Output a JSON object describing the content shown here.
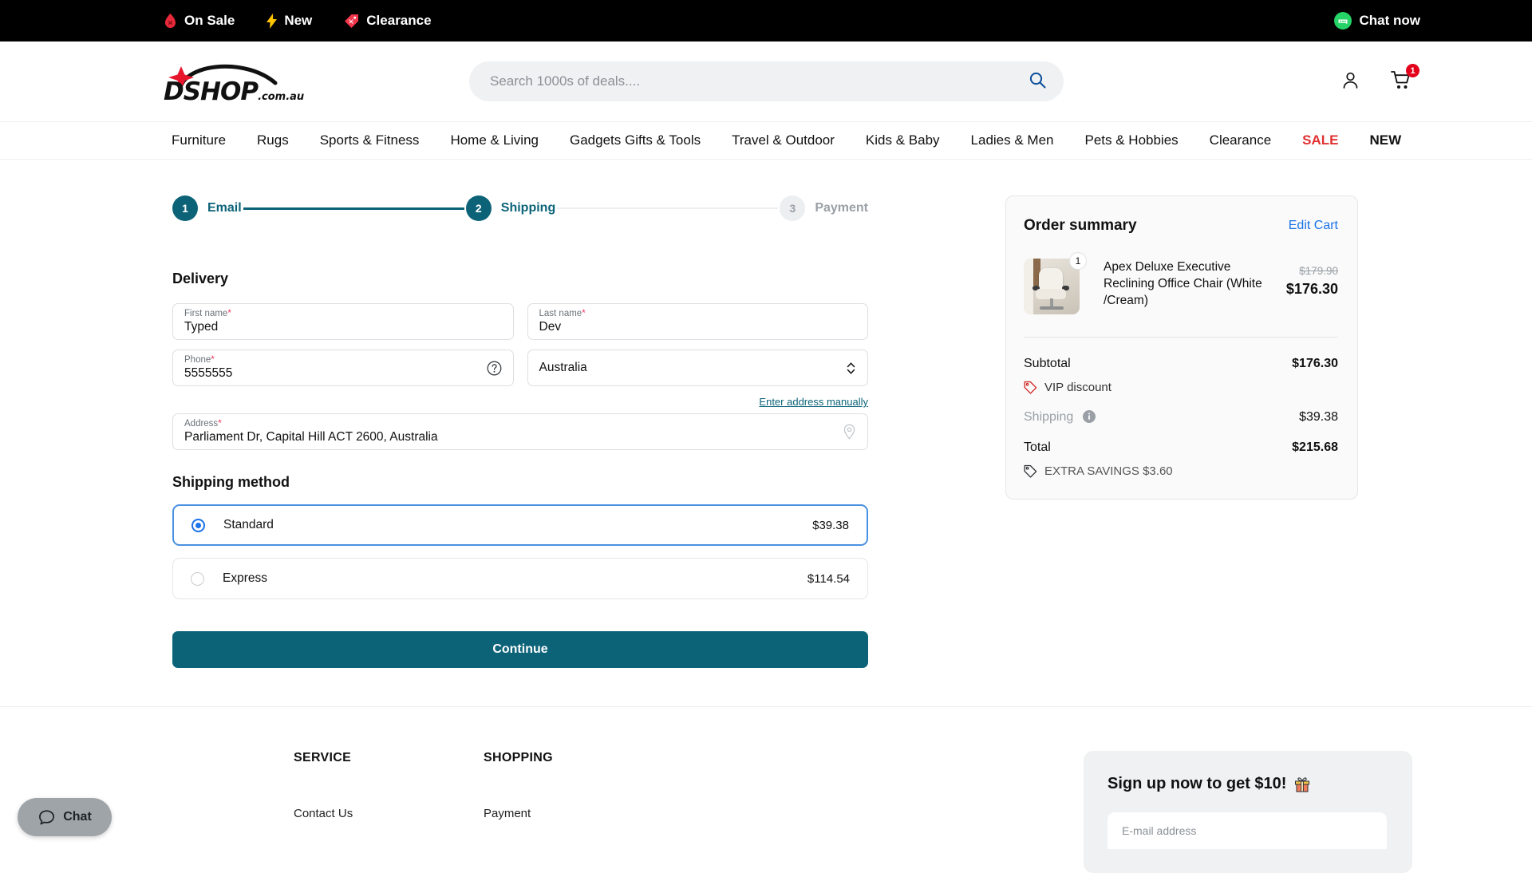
{
  "promo_bar": {
    "links": [
      {
        "label": "On Sale",
        "icon": "fire-drop-icon"
      },
      {
        "label": "New",
        "icon": "lightning-bolt-icon"
      },
      {
        "label": "Clearance",
        "icon": "price-tag-icon"
      }
    ],
    "chat_now": {
      "label": "Chat now",
      "icon": "chat-bubble-icon"
    }
  },
  "header": {
    "logo": {
      "text": "DSHOP",
      "suffix": ".com.au"
    },
    "search": {
      "placeholder": "Search 1000s of deals....",
      "value": ""
    },
    "account_icon": "user-icon",
    "cart_icon": "shopping-cart-icon",
    "cart_count": "1"
  },
  "nav": {
    "items": [
      {
        "label": "Furniture",
        "style": "normal"
      },
      {
        "label": "Rugs",
        "style": "normal"
      },
      {
        "label": "Sports & Fitness",
        "style": "normal"
      },
      {
        "label": "Home & Living",
        "style": "normal"
      },
      {
        "label": "Gadgets Gifts & Tools",
        "style": "normal"
      },
      {
        "label": "Travel & Outdoor",
        "style": "normal"
      },
      {
        "label": "Kids & Baby",
        "style": "normal"
      },
      {
        "label": "Ladies & Men",
        "style": "normal"
      },
      {
        "label": "Pets & Hobbies",
        "style": "normal"
      },
      {
        "label": "Clearance",
        "style": "normal"
      },
      {
        "label": "SALE",
        "style": "sale"
      },
      {
        "label": "NEW",
        "style": "new"
      }
    ]
  },
  "stepper": {
    "steps": [
      {
        "number": "1",
        "label": "Email",
        "state": "done"
      },
      {
        "number": "2",
        "label": "Shipping",
        "state": "active"
      },
      {
        "number": "3",
        "label": "Payment",
        "state": "inactive"
      }
    ]
  },
  "delivery": {
    "title": "Delivery",
    "first_name": {
      "label": "First name",
      "required": "*",
      "value": "Typed"
    },
    "last_name": {
      "label": "Last name",
      "required": "*",
      "value": "Dev"
    },
    "phone": {
      "label": "Phone",
      "required": "*",
      "value": "5555555",
      "help_icon": "question-circle-icon"
    },
    "country": {
      "value": "Australia",
      "icon": "chevron-updown-icon"
    },
    "manual_link": "Enter address manually",
    "address": {
      "label": "Address",
      "required": "*",
      "value": "Parliament Dr, Capital Hill ACT 2600, Australia",
      "icon": "map-pin-icon"
    }
  },
  "shipping_method": {
    "title": "Shipping method",
    "options": [
      {
        "name": "Standard",
        "price": "$39.38",
        "selected": true
      },
      {
        "name": "Express",
        "price": "$114.54",
        "selected": false
      }
    ]
  },
  "continue_button": "Continue",
  "order_summary": {
    "title": "Order summary",
    "edit_cart": "Edit Cart",
    "items": [
      {
        "name": "Apex Deluxe Executive Reclining Office Chair (White /Cream)",
        "qty": "1",
        "old_price": "$179.90",
        "price": "$176.30",
        "image": "office-chair-photo"
      }
    ],
    "totals": [
      {
        "label": "Subtotal",
        "value": "$176.30",
        "bold": true
      },
      {
        "label": "Shipping",
        "value": "$39.38",
        "bold": false,
        "muted": true,
        "info_icon": "info-icon"
      },
      {
        "label": "Total",
        "value": "$215.68",
        "bold": true
      }
    ],
    "vip_discount": {
      "label": "VIP discount",
      "icon": "tag-icon"
    },
    "extra_savings": {
      "label": "EXTRA SAVINGS $3.60",
      "icon": "tag-icon"
    }
  },
  "footer": {
    "columns": [
      {
        "heading": "SERVICE",
        "links": [
          "Contact Us"
        ]
      },
      {
        "heading": "SHOPPING",
        "links": [
          "Payment"
        ]
      }
    ],
    "signup": {
      "title": "Sign up now to get $10!",
      "emoji": "gift-icon",
      "email_placeholder": "E-mail address"
    }
  },
  "chat_widget": {
    "label": "Chat",
    "icon": "chat-bubble-outline-icon"
  },
  "colors": {
    "accent_teal": "#0c6378",
    "sale_red": "#e03131",
    "link_blue": "#1a73e8",
    "badge_red": "#e3001b",
    "required_pink": "#f0325c"
  }
}
